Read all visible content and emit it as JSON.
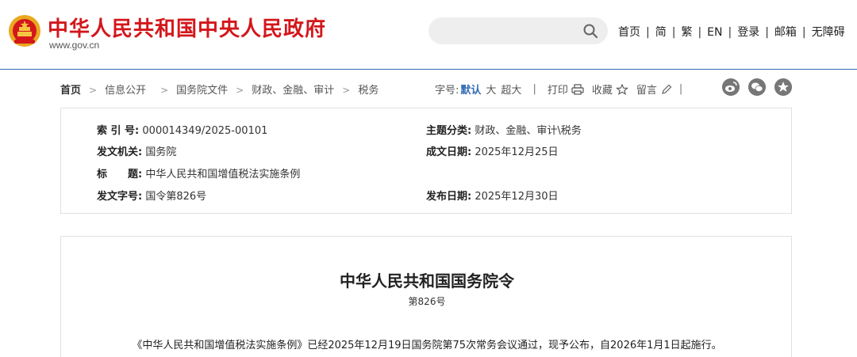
{
  "header": {
    "site_title": "中华人民共和国中央人民政府",
    "site_url": "www.gov.cn",
    "search_placeholder": "",
    "nav": [
      "首页",
      "简",
      "繁",
      "EN",
      "登录",
      "邮箱",
      "无障碍"
    ],
    "nav_separator": "|"
  },
  "breadcrumb": {
    "items": [
      "首页",
      "信息公开",
      "国务院文件",
      "财政、金融、审计",
      "税务"
    ],
    "separator": ">"
  },
  "tools": {
    "font_label": "字号:",
    "font_default": "默认",
    "font_large": "大",
    "font_xlarge": "超大",
    "separator": "|",
    "print": "打印",
    "favorite": "收藏",
    "comment": "留言"
  },
  "share_icons": [
    "weibo-icon",
    "wechat-icon",
    "qzone-icon"
  ],
  "info": {
    "index_label": "索 引 号:",
    "index_value": "000014349/2025-00101",
    "category_label": "主题分类:",
    "category_value": "财政、金融、审计\\税务",
    "issuer_label": "发文机关:",
    "issuer_value": "国务院",
    "written_label": "成文日期:",
    "written_value": "2025年12月25日",
    "title_label": "标　　题:",
    "title_value": "中华人民共和国增值税法实施条例",
    "docno_label": "发文字号:",
    "docno_value": "国令第826号",
    "published_label": "发布日期:",
    "published_value": "2025年12月30日"
  },
  "article": {
    "title": "中华人民共和国国务院令",
    "number": "第826号",
    "body": "《中华人民共和国增值税法实施条例》已经2025年12月19日国务院第75次常务会议通过，现予公布，自2026年1月1日起施行。"
  },
  "colors": {
    "brand_red": "#d3171b",
    "link_blue": "#2f6ab1",
    "border": "#e0e0e0"
  }
}
